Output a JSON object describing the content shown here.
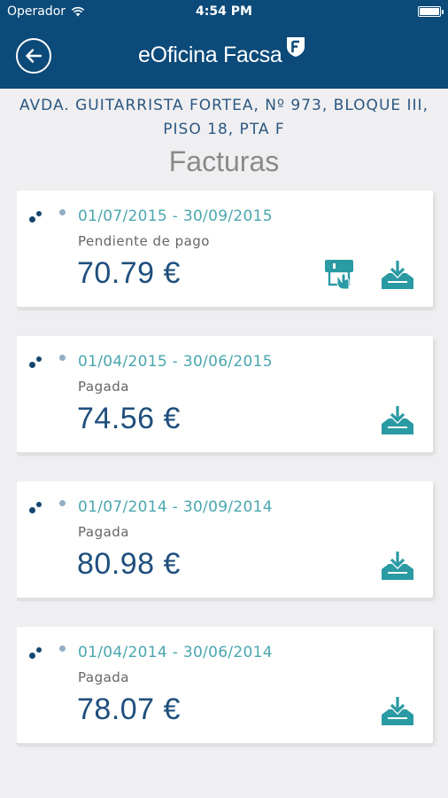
{
  "status_bar": {
    "carrier": "Operador",
    "time": "4:54 PM"
  },
  "header": {
    "brand": "eOficina Facsa",
    "logo_letter": "F"
  },
  "address": {
    "line1": "AVDA. GUITARRISTA FORTEA, Nº 973, BLOQUE III,",
    "line2": "PISO 18, PTA F"
  },
  "page_title": "Facturas",
  "colors": {
    "header_bg": "#0c4a79",
    "accent": "#2a9aa3",
    "amount": "#1f4f7d",
    "background": "#efeff1"
  },
  "invoices": [
    {
      "period": "01/07/2015 - 30/09/2015",
      "status": "Pendiente de pago",
      "amount": "70.79 €",
      "icons": [
        "pay-card-icon",
        "download-icon"
      ]
    },
    {
      "period": "01/04/2015 - 30/06/2015",
      "status": "Pagada",
      "amount": "74.56 €",
      "icons": [
        "download-icon"
      ]
    },
    {
      "period": "01/07/2014 - 30/09/2014",
      "status": "Pagada",
      "amount": "80.98 €",
      "icons": [
        "download-icon"
      ]
    },
    {
      "period": "01/04/2014 - 30/06/2014",
      "status": "Pagada",
      "amount": "78.07 €",
      "icons": [
        "download-icon"
      ]
    }
  ]
}
